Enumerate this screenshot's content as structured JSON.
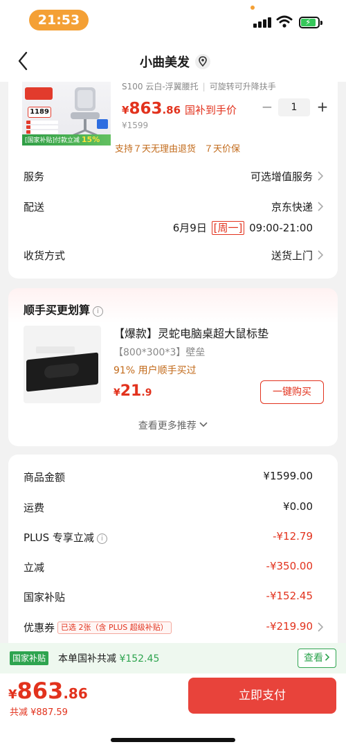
{
  "status_bar": {
    "time": "21:53"
  },
  "nav": {
    "title": "小曲美发"
  },
  "product": {
    "image_texts": {
      "price_tag": "1189",
      "subsidy_band": "[国家补贴]付款立减",
      "subsidy_percent": "15%"
    },
    "spec": "S100 云白-浮翼腰托",
    "spec_extra": "可旋转可升降扶手",
    "price_yen": "¥",
    "price_int": "863",
    "price_dec": ".86",
    "price_tag": "国补到手价",
    "original_price": "¥1599",
    "quantity": "1",
    "promises": [
      "支持７天无理由退货",
      "７天价保"
    ]
  },
  "service": {
    "label": "服务",
    "value": "可选增值服务"
  },
  "delivery": {
    "label": "配送",
    "value": "京东快递",
    "date": "6月9日",
    "weekday": "[周一]",
    "time": "09:00-21:00"
  },
  "receive": {
    "label": "收货方式",
    "value": "送货上门"
  },
  "recommendation": {
    "title": "顺手买更划算",
    "name": "【爆款】灵蛇电脑桌超大鼠标垫",
    "spec": "【800*300*3】壁垒",
    "bought": "91% 用户顺手买过",
    "price_yen": "¥",
    "price_int": "21",
    "price_dec": ".9",
    "buy_label": "一键购买",
    "see_more": "查看更多推荐"
  },
  "summary": {
    "rows": [
      {
        "label": "商品金额",
        "value": "¥1599.00"
      },
      {
        "label": "运费",
        "value": "¥0.00"
      },
      {
        "label": "PLUS 专享立减",
        "value": "-¥12.79"
      },
      {
        "label": "立减",
        "value": "-¥350.00"
      },
      {
        "label": "国家补贴",
        "value": "-¥152.45"
      },
      {
        "label": "优惠券",
        "value": "-¥219.90",
        "tag": "已选 2张（含 PLUS 超级补贴）"
      }
    ]
  },
  "subsidy": {
    "tag": "国家补贴",
    "text": "本单国补共减",
    "amount": "¥152.45",
    "view_label": "查看"
  },
  "bottom": {
    "total_yen": "¥",
    "total_int": "863",
    "total_dec": ".86",
    "saving": "共减 ¥887.59",
    "pay_label": "立即支付"
  },
  "colors": {
    "accent_red": "#e2321d",
    "pay_button": "#e8433b",
    "subsidy_green": "#2ea44f",
    "promise_orange": "#c26a1a",
    "status_pill": "#f4a035"
  },
  "icons": [
    "back-arrow-icon",
    "location-pin-icon",
    "chevron-right-icon",
    "info-icon",
    "chevron-down-icon",
    "wifi-icon",
    "signal-icon",
    "battery-icon"
  ]
}
